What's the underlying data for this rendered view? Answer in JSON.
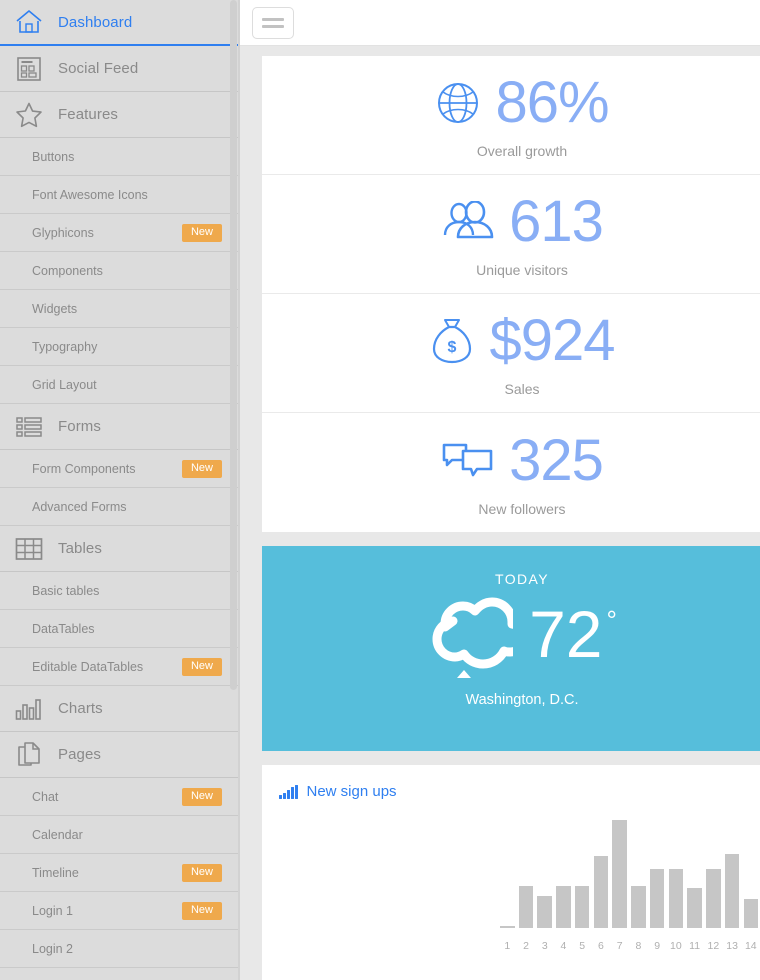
{
  "sidebar": {
    "items": [
      {
        "label": "Dashboard",
        "type": "main",
        "icon": "home-icon",
        "active": true
      },
      {
        "label": "Social Feed",
        "type": "main",
        "icon": "layout-icon",
        "active": false
      },
      {
        "label": "Features",
        "type": "main",
        "icon": "star-icon",
        "active": false
      },
      {
        "label": "Buttons",
        "type": "sub",
        "badge": ""
      },
      {
        "label": "Font Awesome Icons",
        "type": "sub",
        "badge": ""
      },
      {
        "label": "Glyphicons",
        "type": "sub",
        "badge": "New"
      },
      {
        "label": "Components",
        "type": "sub",
        "badge": ""
      },
      {
        "label": "Widgets",
        "type": "sub",
        "badge": ""
      },
      {
        "label": "Typography",
        "type": "sub",
        "badge": ""
      },
      {
        "label": "Grid Layout",
        "type": "sub",
        "badge": ""
      },
      {
        "label": "Forms",
        "type": "main",
        "icon": "form-list-icon",
        "active": false
      },
      {
        "label": "Form Components",
        "type": "sub",
        "badge": "New"
      },
      {
        "label": "Advanced Forms",
        "type": "sub",
        "badge": ""
      },
      {
        "label": "Tables",
        "type": "main",
        "icon": "table-icon",
        "active": false
      },
      {
        "label": "Basic tables",
        "type": "sub",
        "badge": ""
      },
      {
        "label": "DataTables",
        "type": "sub",
        "badge": ""
      },
      {
        "label": "Editable DataTables",
        "type": "sub",
        "badge": "New"
      },
      {
        "label": "Charts",
        "type": "main",
        "icon": "bar-chart-icon",
        "active": false
      },
      {
        "label": "Pages",
        "type": "main",
        "icon": "pages-icon",
        "active": false
      },
      {
        "label": "Chat",
        "type": "sub",
        "badge": "New"
      },
      {
        "label": "Calendar",
        "type": "sub",
        "badge": ""
      },
      {
        "label": "Timeline",
        "type": "sub",
        "badge": "New"
      },
      {
        "label": "Login 1",
        "type": "sub",
        "badge": "New"
      },
      {
        "label": "Login 2",
        "type": "sub",
        "badge": ""
      }
    ]
  },
  "topbar": {
    "menu_toggle": "menu-toggle",
    "menu_toggle_label": ""
  },
  "stats": [
    {
      "value": "86%",
      "label": "Overall growth",
      "icon": "globe-icon"
    },
    {
      "value": "613",
      "label": "Unique visitors",
      "icon": "users-icon"
    },
    {
      "value": "$924",
      "label": "Sales",
      "icon": "money-bag-icon"
    },
    {
      "value": "325",
      "label": "New followers",
      "icon": "chat-bubbles-icon"
    }
  ],
  "weather": {
    "today": "TODAY",
    "temperature": "72",
    "degree": "°",
    "city": "Washington, D.C.",
    "condition_icon": "cloud-icon"
  },
  "chart_card": {
    "title": "New sign ups",
    "icon": "signal-bars-icon"
  },
  "colors": {
    "accent_blue": "#2f7ff0",
    "stat_number_blue": "#89aef5",
    "weather_blue": "#56bedb",
    "badge_orange": "#efa94c",
    "sidebar_bg": "#dcdcdc",
    "page_bg": "#e8e8e8",
    "bar_gray": "#c6c6c6"
  },
  "chart_data": {
    "type": "bar",
    "title": "New sign ups",
    "categories": [
      "1",
      "2",
      "3",
      "4",
      "5",
      "6",
      "7",
      "8",
      "9",
      "10",
      "11",
      "12",
      "13",
      "14"
    ],
    "values": [
      1,
      34,
      26,
      34,
      34,
      59,
      88,
      34,
      48,
      48,
      33,
      48,
      60,
      24
    ],
    "xlabel": "",
    "ylabel": "",
    "ylim": [
      0,
      100
    ],
    "grid": false,
    "legend": "none"
  }
}
